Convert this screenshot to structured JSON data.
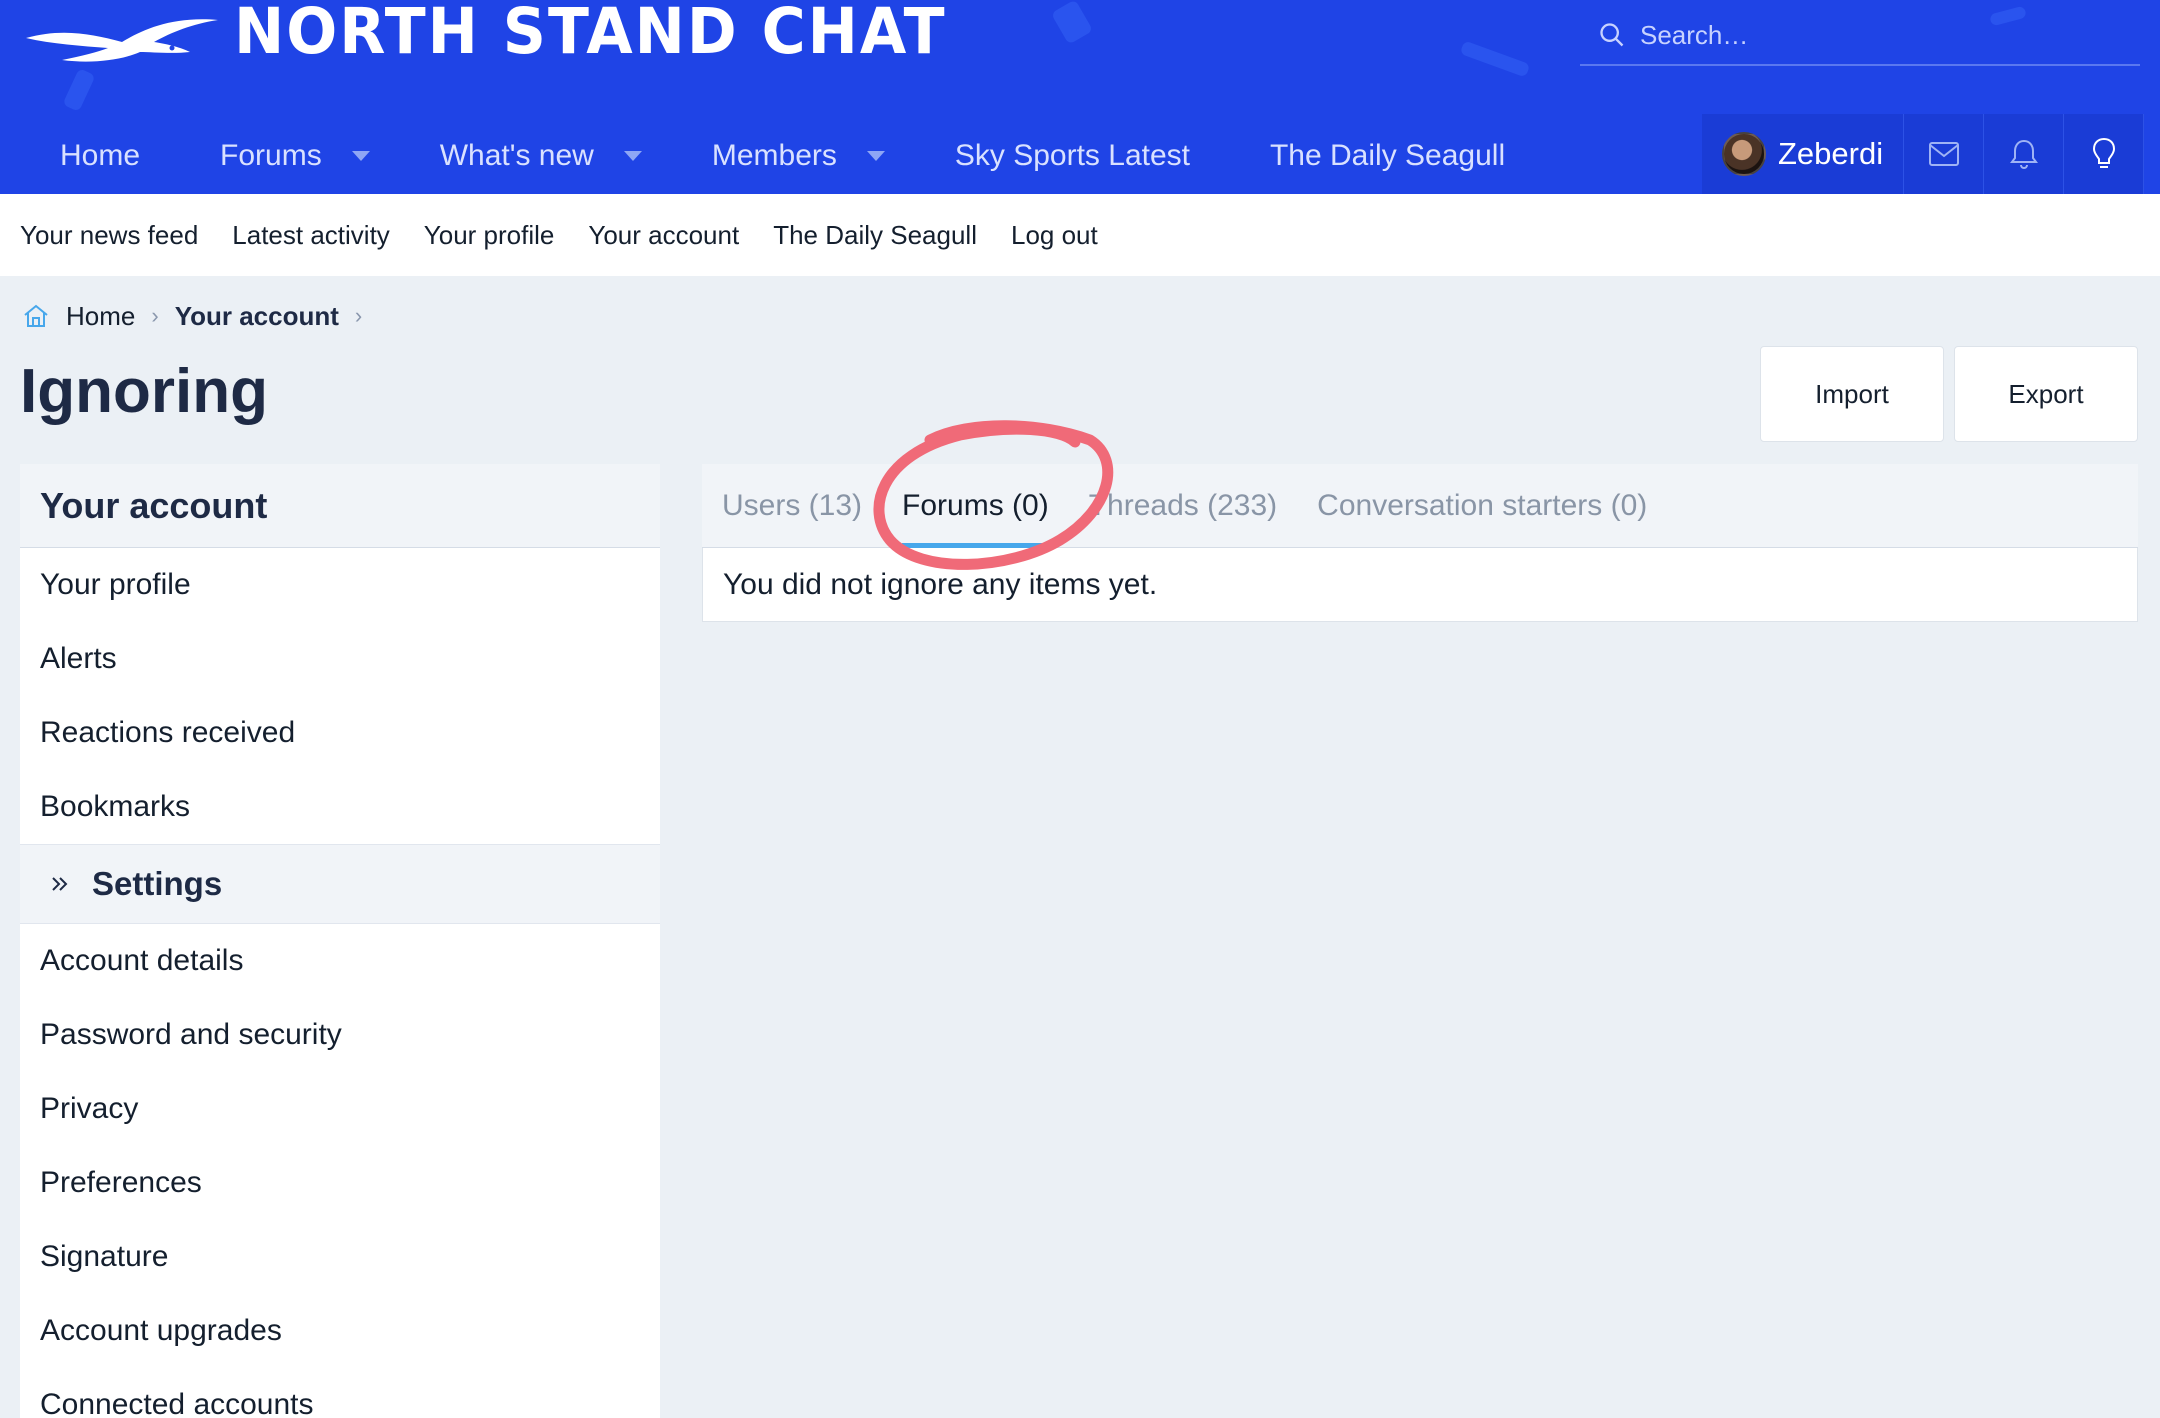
{
  "header": {
    "site_name": "NORTH STAND CHAT",
    "search_placeholder": "Search…",
    "nav": [
      {
        "label": "Home"
      },
      {
        "label": "Forums"
      },
      {
        "label": "What's new"
      },
      {
        "label": "Members"
      },
      {
        "label": "Sky Sports Latest"
      },
      {
        "label": "The Daily Seagull"
      }
    ],
    "user": {
      "name": "Zeberdi"
    }
  },
  "subnav": [
    "Your news feed",
    "Latest activity",
    "Your profile",
    "Your account",
    "The Daily Seagull",
    "Log out"
  ],
  "breadcrumb": [
    "Home",
    "Your account"
  ],
  "page": {
    "title": "Ignoring",
    "import_label": "Import",
    "export_label": "Export"
  },
  "sidebar": {
    "heading": "Your account",
    "items": [
      "Your profile",
      "Alerts",
      "Reactions received",
      "Bookmarks"
    ],
    "section": "Settings",
    "settings_items": [
      "Account details",
      "Password and security",
      "Privacy",
      "Preferences",
      "Signature",
      "Account upgrades",
      "Connected accounts"
    ]
  },
  "tabs": [
    "Users (13)",
    "Forums (0)",
    "Threads (233)",
    "Conversation starters (0)"
  ],
  "active_tab": "Forums (0)",
  "empty_message": "You did not ignore any items yet.",
  "colors": {
    "header_bg": "#1f44e6",
    "tab_underline": "#47a7eb",
    "annotation": "#f06a78"
  }
}
